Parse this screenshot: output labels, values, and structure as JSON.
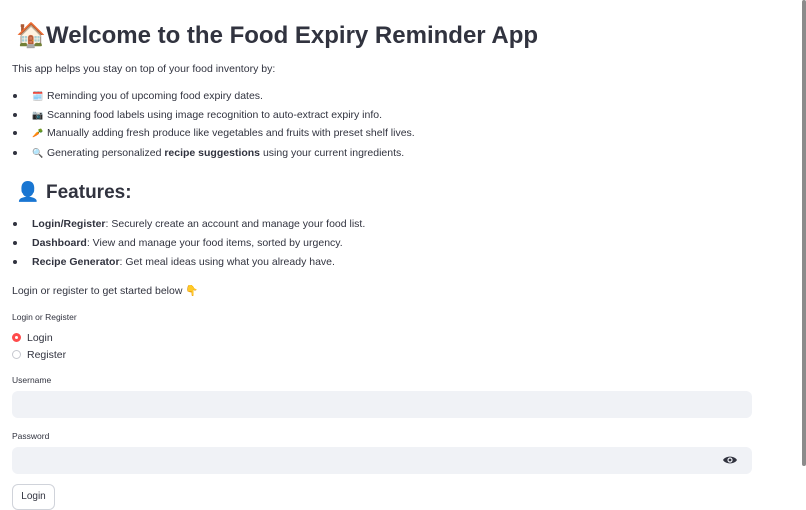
{
  "header": {
    "title_emoji": "🏠",
    "title_text": "Welcome to the Food Expiry Reminder App"
  },
  "intro": {
    "text": "This app helps you stay on top of your food inventory by:",
    "bullets": [
      {
        "icon": "🗓️",
        "text": "Reminding you of upcoming food expiry dates."
      },
      {
        "icon": "📷",
        "text": "Scanning food labels using image recognition to auto-extract expiry info."
      },
      {
        "icon": "🥕",
        "text": "Manually adding fresh produce like vegetables and fruits with preset shelf lives."
      },
      {
        "icon": "🔍",
        "text_before": "Generating personalized ",
        "bold": "recipe suggestions",
        "text_after": " using your current ingredients."
      }
    ]
  },
  "features": {
    "heading_emoji": "👤",
    "heading_text": "Features:",
    "items": [
      {
        "bold": "Login/Register",
        "text": ": Securely create an account and manage your food list."
      },
      {
        "bold": "Dashboard",
        "text": ": View and manage your food items, sorted by urgency."
      },
      {
        "bold": "Recipe Generator",
        "text": ": Get meal ideas using what you already have."
      }
    ]
  },
  "prompt": {
    "text": "Login or register to get started below",
    "emoji": "👇"
  },
  "auth": {
    "label": "Login or Register",
    "options": [
      "Login",
      "Register"
    ],
    "selected": "Login"
  },
  "username": {
    "label": "Username",
    "value": ""
  },
  "password": {
    "label": "Password",
    "value": ""
  },
  "login_button": {
    "label": "Login"
  },
  "colors": {
    "accent": "#ff4b4b",
    "input_bg": "#f0f2f6",
    "text": "#31333f"
  }
}
